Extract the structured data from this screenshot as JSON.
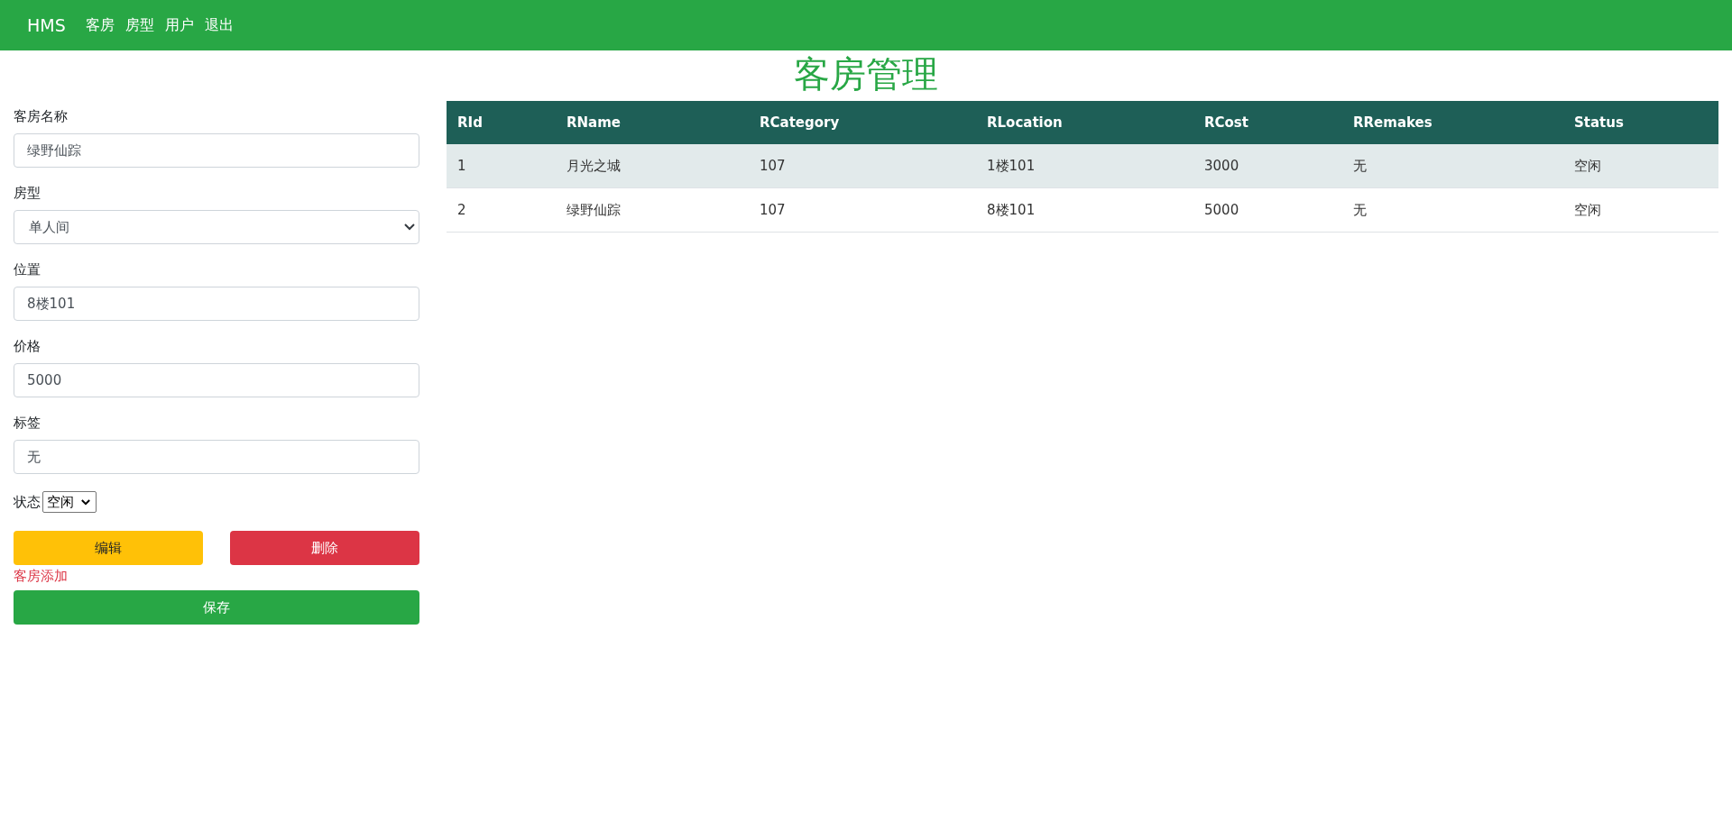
{
  "navbar": {
    "brand": "HMS",
    "links": [
      "客房",
      "房型",
      "用户",
      "退出"
    ]
  },
  "title": "客房管理",
  "form": {
    "fields": [
      {
        "kind": "input",
        "label": "客房名称",
        "value": "绿野仙踪"
      },
      {
        "kind": "select",
        "label": "房型",
        "value": "单人间"
      },
      {
        "kind": "input",
        "label": "位置",
        "value": "8楼101"
      },
      {
        "kind": "input",
        "label": "价格",
        "value": "5000"
      },
      {
        "kind": "input",
        "label": "标签",
        "value": "无"
      }
    ],
    "status": {
      "label": "状态",
      "value": "空闲"
    },
    "edit_button": "编辑",
    "delete_button": "删除",
    "message": "客房添加",
    "save_button": "保存"
  },
  "table": {
    "columns": [
      "RId",
      "RName",
      "RCategory",
      "RLocation",
      "RCost",
      "RRemakes",
      "Status"
    ],
    "rows": [
      [
        "1",
        "月光之城",
        "107",
        "1楼101",
        "3000",
        "无",
        "空闲"
      ],
      [
        "2",
        "绿野仙踪",
        "107",
        "8楼101",
        "5000",
        "无",
        "空闲"
      ]
    ]
  }
}
